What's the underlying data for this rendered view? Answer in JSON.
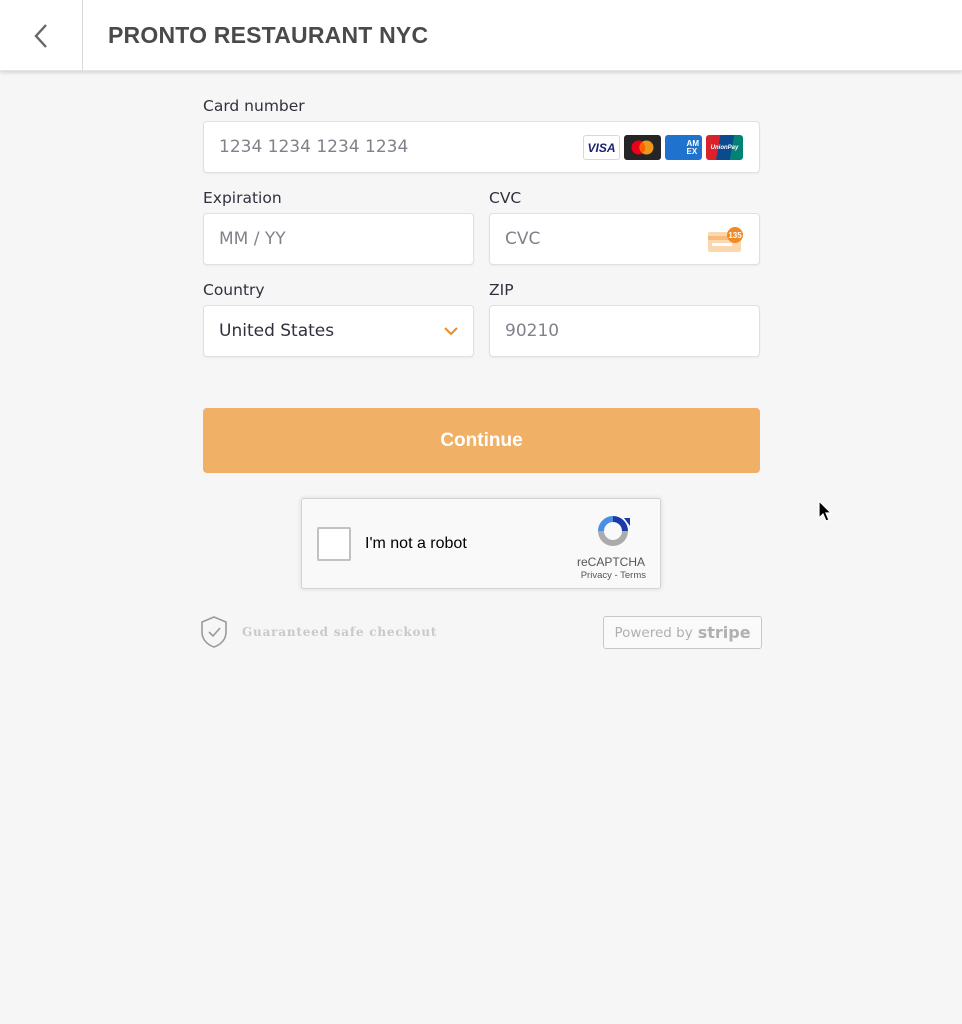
{
  "header": {
    "title": "PRONTO RESTAURANT NYC",
    "back_icon": "chevron-left-icon"
  },
  "form": {
    "card_number": {
      "label": "Card number",
      "placeholder": "1234 1234 1234 1234",
      "value": "",
      "brands": [
        "VISA",
        "Mastercard",
        "AMEX",
        "UnionPay"
      ]
    },
    "expiration": {
      "label": "Expiration",
      "placeholder": "MM / YY",
      "value": ""
    },
    "cvc": {
      "label": "CVC",
      "placeholder": "CVC",
      "value": "",
      "icon_badge": "135"
    },
    "country": {
      "label": "Country",
      "selected": "United States"
    },
    "zip": {
      "label": "ZIP",
      "placeholder": "90210",
      "value": ""
    },
    "continue_label": "Continue"
  },
  "captcha": {
    "label": "I'm not a robot",
    "brand": "reCAPTCHA",
    "links": "Privacy - Terms",
    "checked": false
  },
  "footer": {
    "safe_text": "Guaranteed safe checkout",
    "powered_by": "Powered by",
    "stripe": "stripe"
  },
  "colors": {
    "accent": "#f0b066",
    "chevron": "#f08a24",
    "background": "#f6f6f6"
  }
}
